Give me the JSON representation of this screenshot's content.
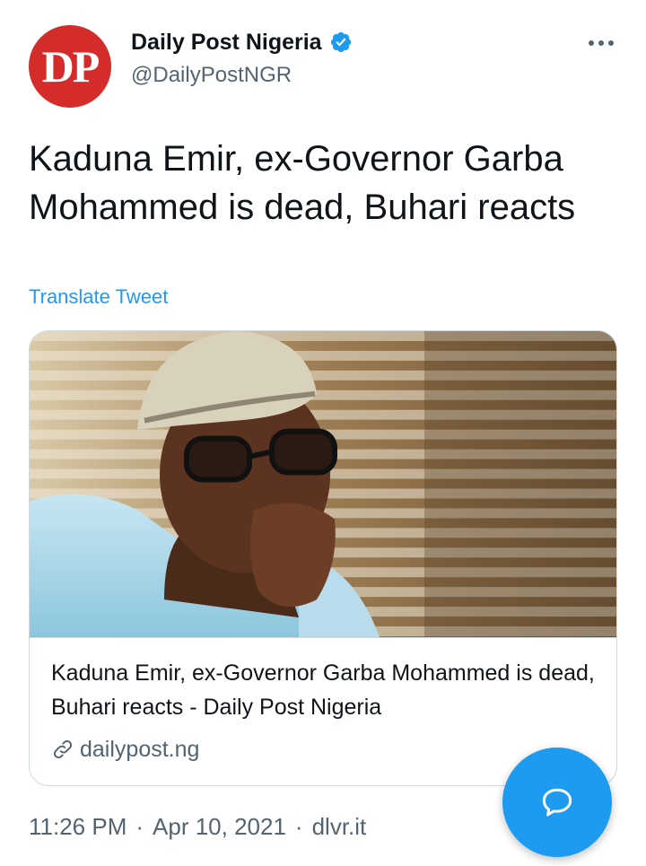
{
  "author": {
    "avatar_text": "DP",
    "display_name": "Daily Post Nigeria",
    "handle": "@DailyPostNGR",
    "verified": true,
    "avatar_color": "#d42b2b"
  },
  "tweet": {
    "text": "Kaduna Emir, ex-Governor Garba Mohammed is dead, Buhari reacts",
    "translate_label": "Translate Tweet"
  },
  "card": {
    "title": "Kaduna Emir, ex-Governor Garba Mohammed is dead, Buhari reacts - Daily Post Nigeria",
    "domain": "dailypost.ng",
    "image_icon": "photo-of-man-in-cap-and-glasses"
  },
  "meta": {
    "time": "11:26 PM",
    "separator": "·",
    "date": "Apr 10, 2021",
    "source": "dlvr.it"
  },
  "colors": {
    "accent": "#1d9bf0",
    "secondary_text": "#536471",
    "border": "#cfd9de"
  },
  "icons": {
    "more": "more-horizontal-icon",
    "verified": "verified-badge-icon",
    "link": "link-icon",
    "compose": "compose-reply-icon"
  }
}
